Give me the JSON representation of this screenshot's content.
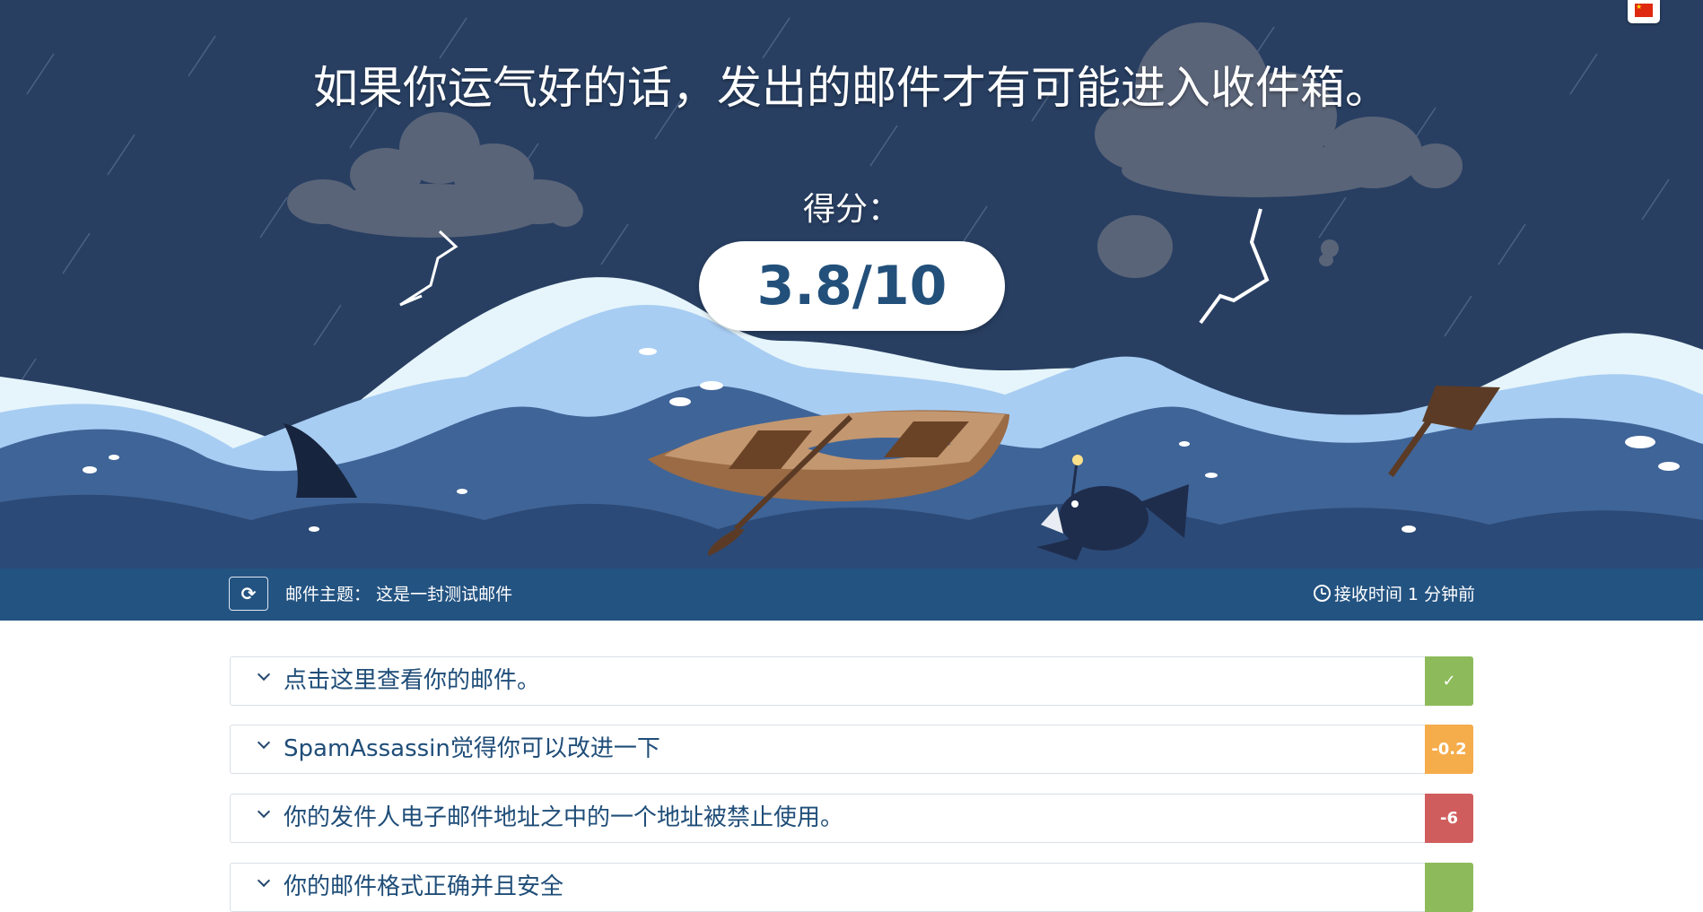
{
  "language_flag": "cn-flag-icon",
  "hero": {
    "title": "如果你运气好的话，发出的邮件才有可能进入收件箱。",
    "score_label": "得分：",
    "score": "3.8/10"
  },
  "infobar": {
    "refresh_icon": "refresh-icon",
    "subject_label": "邮件主题：",
    "subject_value": "这是一封测试邮件",
    "clock_icon": "clock-icon",
    "received": "接收时间 1 分钟前"
  },
  "results": [
    {
      "text": "点击这里查看你的邮件。",
      "badge": "✓",
      "color": "#8dbb5b"
    },
    {
      "text": "SpamAssassin觉得你可以改进一下",
      "badge": "-0.2",
      "color": "#f5ac4a"
    },
    {
      "text": "你的发件人电子邮件地址之中的一个地址被禁止使用。",
      "badge": "-6",
      "color": "#d05d5d"
    },
    {
      "text": "你的邮件格式正确并且安全",
      "badge": "",
      "color": "#8dbb5b"
    }
  ],
  "colors": {
    "sky": "#283f62",
    "infobar": "#235381",
    "score_text": "#22507a",
    "ok": "#8dbb5b",
    "warn": "#f5ac4a",
    "bad": "#d05d5d"
  }
}
